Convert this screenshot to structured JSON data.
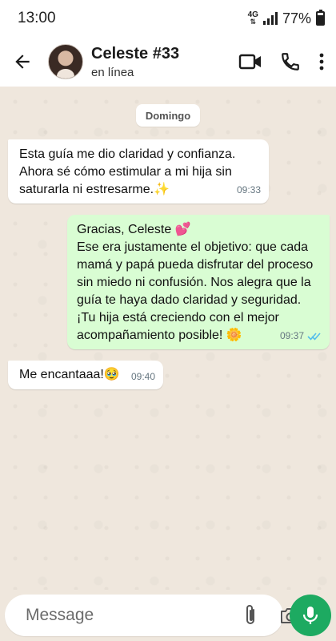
{
  "status_bar": {
    "time": "13:00",
    "network": "4G",
    "battery_percent": "77%",
    "battery_level": 0.77
  },
  "header": {
    "contact_name": "Celeste #33",
    "contact_status": "en línea",
    "icons": [
      "back-arrow-icon",
      "video-call-icon",
      "phone-icon",
      "more-vert-icon"
    ]
  },
  "chat": {
    "date_chip": "Domingo",
    "messages": [
      {
        "direction": "incoming",
        "text": "Esta guía me dio claridad y confianza.\nAhora sé cómo estimular a mi hija sin saturarla ni estresarme.✨",
        "time": "09:33"
      },
      {
        "direction": "outgoing",
        "text": "Gracias, Celeste 💕\nEse era justamente el objetivo: que cada mamá y papá pueda disfrutar del proceso sin miedo ni confusión. Nos alegra que la guía te haya dado claridad y seguridad. ¡Tu hija está creciendo con el mejor acompañamiento posible! 🌼",
        "time": "09:37",
        "read": true
      },
      {
        "direction": "incoming",
        "text": "Me encantaaa!🥹",
        "time": "09:40"
      }
    ]
  },
  "composer": {
    "placeholder": "Message",
    "icons": [
      "sticker-icon",
      "attach-icon",
      "camera-icon",
      "mic-icon"
    ]
  },
  "colors": {
    "outgoing_bubble": "#d9fdd3",
    "incoming_bubble": "#ffffff",
    "chat_background": "#efe7dd",
    "mic_button": "#1daa61",
    "read_ticks": "#53bdeb"
  }
}
